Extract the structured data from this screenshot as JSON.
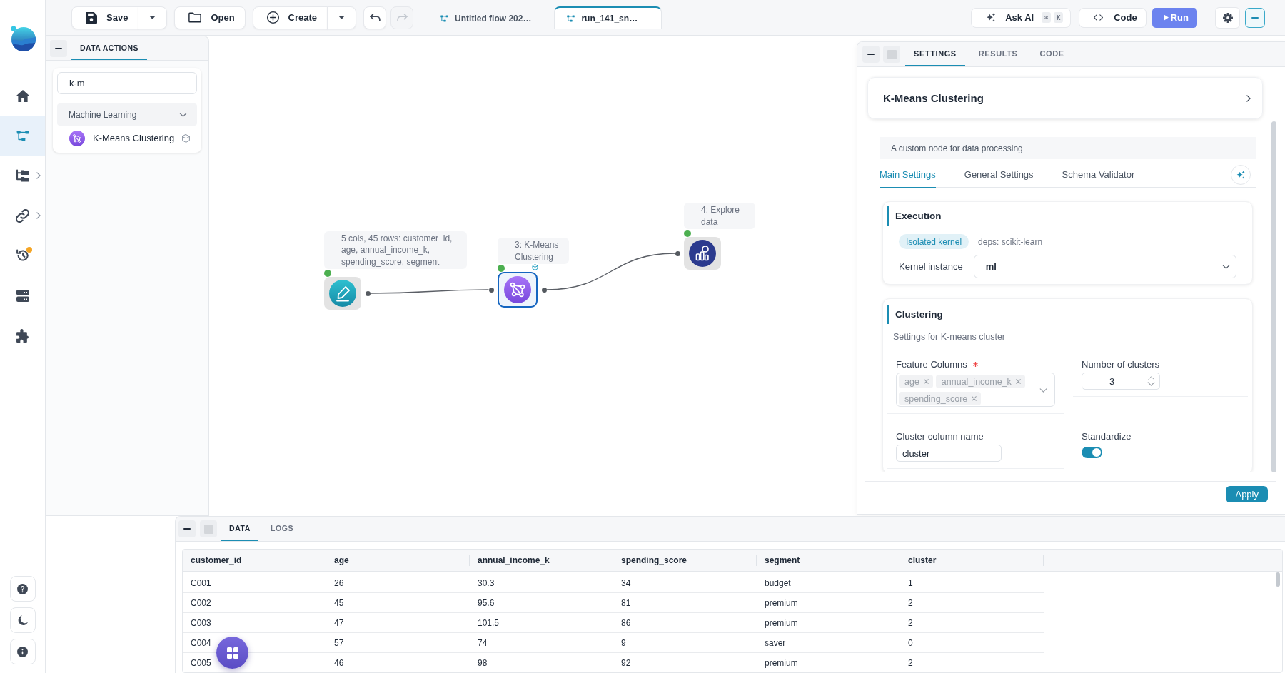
{
  "nav_sidebar": {
    "items": [
      {
        "selected": false,
        "expandable": false,
        "notification": false
      },
      {
        "selected": true,
        "expandable": false,
        "notification": false
      },
      {
        "selected": false,
        "expandable": true,
        "notification": false
      },
      {
        "selected": false,
        "expandable": true,
        "notification": false
      },
      {
        "selected": false,
        "expandable": false,
        "notification": true
      },
      {
        "selected": false,
        "expandable": false,
        "notification": false
      },
      {
        "selected": false,
        "expandable": false,
        "notification": false
      }
    ]
  },
  "toolbar": {
    "file_buttons": [
      {
        "label": "Save",
        "split": true
      },
      {
        "label": "Open",
        "split": false
      },
      {
        "label": "Create",
        "split": true
      }
    ],
    "history_buttons": [
      {
        "disabled": false
      },
      {
        "disabled": true
      }
    ],
    "flow_tabs": [
      {
        "label": "Untitled flow 202…",
        "selected": false
      },
      {
        "label": "run_141_sn…",
        "selected": true
      }
    ],
    "ask_ai": {
      "label": "Ask AI",
      "shortcut_keys": [
        "⌘",
        "K"
      ]
    },
    "code_button": {
      "label": "Code"
    },
    "run_button": {
      "label": "Run"
    }
  },
  "data_actions": {
    "tabs": [
      {
        "label": "DATA ACTIONS",
        "selected": true
      }
    ],
    "search": {
      "value": "k-m"
    },
    "groups": [
      {
        "label": "Machine Learning",
        "expanded": true,
        "items": [
          {
            "label": "K-Means Clustering",
            "kernel_badge": true
          }
        ]
      }
    ]
  },
  "flow_canvas": {
    "nodes": [
      {
        "kind": "input",
        "label": "5 cols, 45 rows: customer_id, age, annual_income_k, spending_score, segment",
        "selected": false,
        "succeeded": true,
        "kernel_badge": false,
        "output_connected": true
      },
      {
        "kind": "kmeans",
        "label": "3: K-Means Clustering",
        "selected": true,
        "succeeded": true,
        "kernel_badge": true,
        "output_connected": true
      },
      {
        "kind": "explore",
        "label": "4: Explore data",
        "selected": false,
        "succeeded": true,
        "kernel_badge": false,
        "output_connected": false
      }
    ]
  },
  "settings_panel": {
    "tabs": [
      {
        "label": "SETTINGS",
        "selected": true
      },
      {
        "label": "RESULTS",
        "selected": false
      },
      {
        "label": "CODE",
        "selected": false
      }
    ],
    "node_title": "K-Means Clustering",
    "description": "A custom node for data processing",
    "sub_tabs": [
      {
        "label": "Main Settings",
        "selected": true
      },
      {
        "label": "General Settings",
        "selected": false
      },
      {
        "label": "Schema Validator",
        "selected": false
      }
    ],
    "execution": {
      "title": "Execution",
      "badge": "Isolated kernel",
      "deps": "deps: scikit-learn",
      "kernel_field": {
        "label": "Kernel instance",
        "value": "ml"
      }
    },
    "clustering": {
      "title": "Clustering",
      "subtitle": "Settings for K-means cluster",
      "fields": [
        {
          "kind": "multiselect",
          "label": "Feature Columns",
          "required": true,
          "tags": [
            "age",
            "annual_income_k",
            "spending_score"
          ]
        },
        {
          "kind": "number",
          "label": "Number of clusters",
          "required": false,
          "value": "3"
        },
        {
          "kind": "text",
          "label": "Cluster column name",
          "required": false,
          "value": "cluster"
        },
        {
          "kind": "toggle",
          "label": "Standardize",
          "required": false,
          "on": true
        }
      ]
    },
    "apply_button": "Apply"
  },
  "bottom_panel": {
    "tabs": [
      {
        "label": "DATA",
        "selected": true
      },
      {
        "label": "LOGS",
        "selected": false
      }
    ],
    "table": {
      "columns": [
        "customer_id",
        "age",
        "annual_income_k",
        "spending_score",
        "segment",
        "cluster"
      ],
      "rows": [
        [
          "C001",
          "26",
          "30.3",
          "34",
          "budget",
          "1"
        ],
        [
          "C002",
          "45",
          "95.6",
          "81",
          "premium",
          "2"
        ],
        [
          "C003",
          "47",
          "101.5",
          "86",
          "premium",
          "2"
        ],
        [
          "C004",
          "57",
          "74",
          "9",
          "saver",
          "0"
        ],
        [
          "C005",
          "46",
          "98",
          "92",
          "premium",
          "2"
        ]
      ]
    }
  }
}
